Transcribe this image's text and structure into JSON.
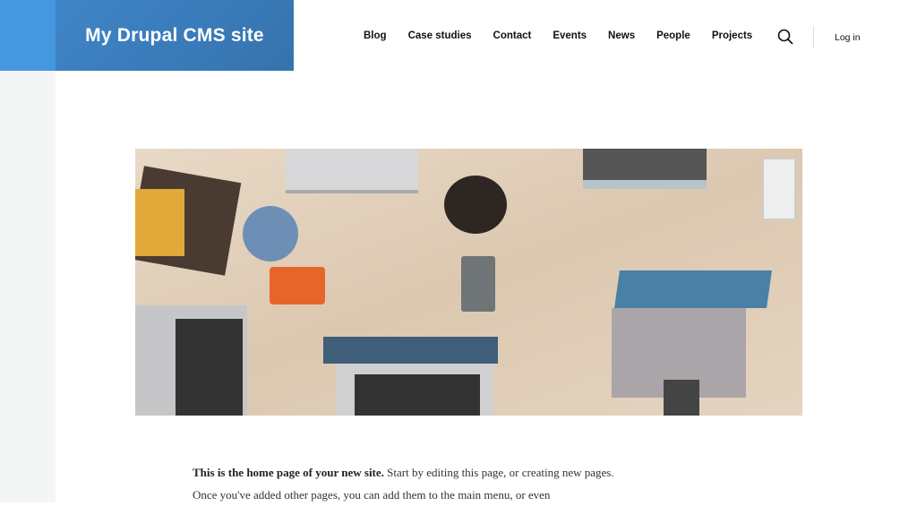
{
  "site": {
    "title": "My Drupal CMS site"
  },
  "nav": {
    "items": [
      "Blog",
      "Case studies",
      "Contact",
      "Events",
      "News",
      "People",
      "Projects"
    ],
    "login": "Log in",
    "search_icon": "search-icon"
  },
  "colors": {
    "brand": "#3f85c8",
    "brand_light": "#4597e0"
  },
  "hero": {
    "description": "hero-image"
  },
  "body": {
    "intro_bold": "This is the home page of your new site.",
    "intro_rest": " Start by editing this page, or creating new pages. Once you've added other pages, you can add them to the main menu, or even"
  }
}
